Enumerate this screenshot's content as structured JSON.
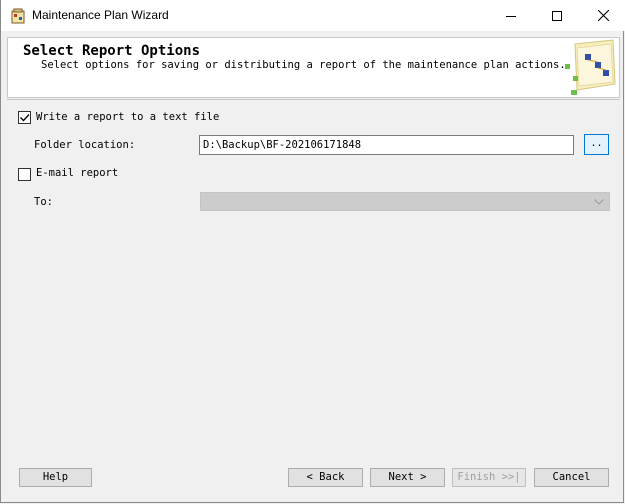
{
  "window": {
    "title": "Maintenance Plan Wizard"
  },
  "header": {
    "title": "Select Report Options",
    "subtitle": "Select options for saving or distributing a report of the maintenance plan actions."
  },
  "options": {
    "write_report": {
      "label": "Write a report to a text file",
      "checked": true
    },
    "folder": {
      "label": "Folder location:",
      "value": "D:\\Backup\\BF-202106171848",
      "browse_label": ".."
    },
    "email_report": {
      "label": "E-mail report",
      "checked": false
    },
    "to": {
      "label": "To:",
      "value": ""
    }
  },
  "buttons": {
    "help": "Help",
    "back": "< Back",
    "next": "Next >",
    "finish": "Finish >>|",
    "cancel": "Cancel"
  },
  "colors": {
    "focus_border": "#0078d7",
    "disabled_bg": "#cccccc"
  }
}
